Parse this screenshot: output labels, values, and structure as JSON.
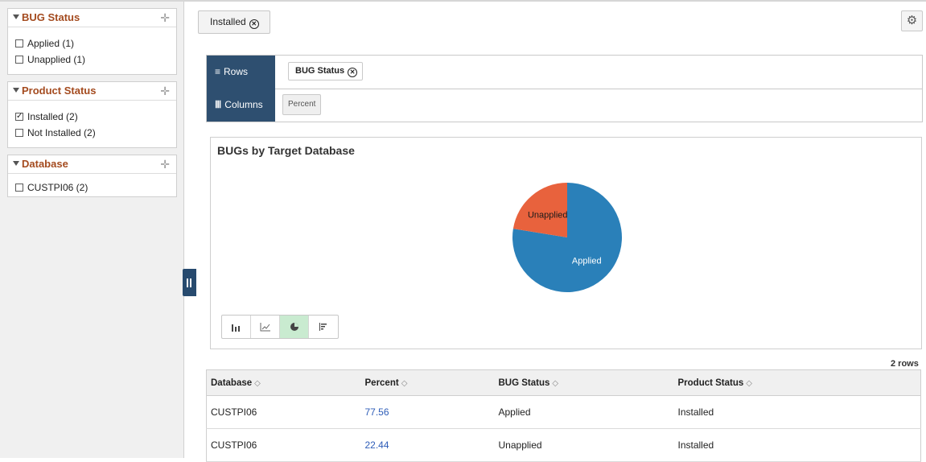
{
  "filters": [
    {
      "title": "BUG Status",
      "items": [
        {
          "label": "Applied (1)",
          "checked": false
        },
        {
          "label": "Unapplied (1)",
          "checked": false
        }
      ]
    },
    {
      "title": "Product Status",
      "items": [
        {
          "label": "Installed (2)",
          "checked": true
        },
        {
          "label": "Not Installed (2)",
          "checked": false
        }
      ]
    },
    {
      "title": "Database",
      "items": [
        {
          "label": "CUSTPI06 (2)",
          "checked": false
        }
      ]
    }
  ],
  "active_filter_chip": "Installed",
  "pivot": {
    "rows_label": "Rows",
    "rows_field": "BUG Status",
    "columns_label": "Columns",
    "columns_field": "Percent"
  },
  "chart_data": {
    "type": "pie",
    "title": "BUGs by Target Database",
    "categories": [
      "Applied",
      "Unapplied"
    ],
    "values": [
      77.56,
      22.44
    ],
    "colors": [
      "#2a80b9",
      "#e8623d"
    ]
  },
  "chart_types": [
    "bar-chart-icon",
    "line-chart-icon",
    "pie-chart-icon",
    "horizontal-bar-chart-icon"
  ],
  "selected_chart_type": "pie-chart-icon",
  "grid": {
    "row_count": "2 rows",
    "columns": [
      "Database",
      "Percent",
      "BUG Status",
      "Product Status"
    ],
    "rows": [
      [
        "CUSTPI06",
        "77.56",
        "Applied",
        "Installed"
      ],
      [
        "CUSTPI06",
        "22.44",
        "Unapplied",
        "Installed"
      ]
    ]
  }
}
